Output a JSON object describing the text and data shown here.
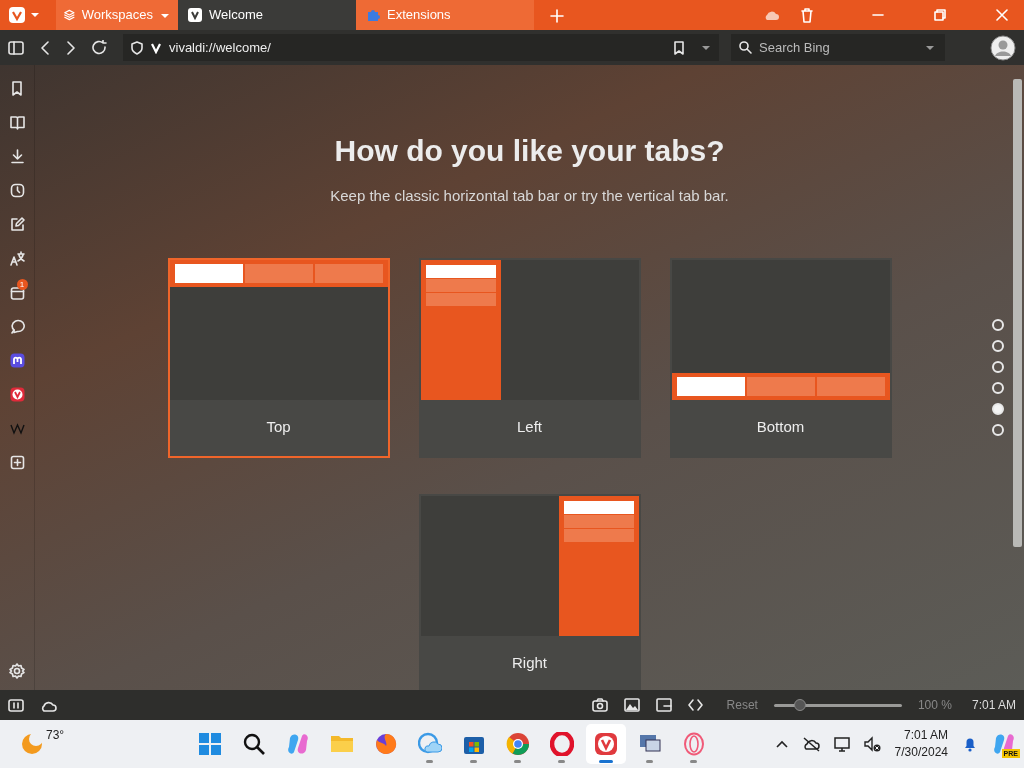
{
  "tab_bar": {
    "workspaces": "Workspaces",
    "tabs": [
      {
        "label": "Welcome",
        "selected": true,
        "kind": "vivaldi"
      },
      {
        "label": "Extensions",
        "selected": false,
        "kind": "puzzle"
      }
    ]
  },
  "address_bar": {
    "url": "vivaldi://welcome/",
    "search_placeholder": "Search Bing"
  },
  "side_panel": {
    "badge": "1"
  },
  "page": {
    "title": "How do you like your tabs?",
    "subtitle": "Keep the classic horizontal tab bar or try the vertical tab bar.",
    "options": [
      {
        "label": "Top",
        "kind": "top",
        "selected": true
      },
      {
        "label": "Left",
        "kind": "left",
        "selected": false
      },
      {
        "label": "Bottom",
        "kind": "bottom",
        "selected": false
      },
      {
        "label": "Right",
        "kind": "right",
        "selected": false
      }
    ],
    "steps": [
      {
        "selected": false
      },
      {
        "selected": false
      },
      {
        "selected": false
      },
      {
        "selected": false
      },
      {
        "selected": true
      },
      {
        "selected": false
      }
    ]
  },
  "status_bar": {
    "reset": "Reset",
    "zoom_slider": {
      "level": 0.2
    },
    "zoom": "100 %",
    "clock": "7:01 AM"
  },
  "taskbar": {
    "weather": "73°",
    "apps": [
      {
        "kind": "start",
        "open": false,
        "selected": false
      },
      {
        "kind": "search",
        "open": false,
        "selected": false
      },
      {
        "kind": "swirl",
        "open": false,
        "selected": false
      },
      {
        "kind": "folder",
        "open": false,
        "selected": false
      },
      {
        "kind": "globe",
        "open": false,
        "selected": false
      },
      {
        "kind": "cloud",
        "open": true,
        "selected": false
      },
      {
        "kind": "bag",
        "open": true,
        "selected": false
      },
      {
        "kind": "wheel",
        "open": true,
        "selected": false
      },
      {
        "kind": "ring",
        "open": true,
        "selected": false
      },
      {
        "kind": "vlogo",
        "open": true,
        "selected": true
      },
      {
        "kind": "monitor",
        "open": true,
        "selected": false
      },
      {
        "kind": "thinring",
        "open": true,
        "selected": false
      }
    ],
    "time": "7:01 AM",
    "date": "7/30/2024",
    "tray_badge": "PRE"
  }
}
